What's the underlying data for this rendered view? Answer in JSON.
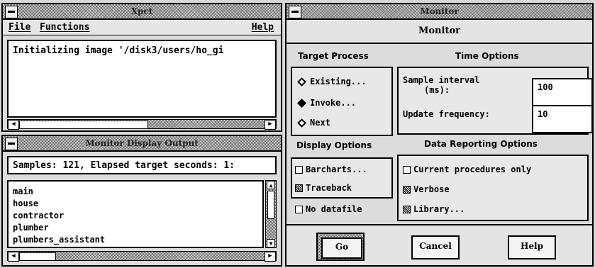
{
  "xpct": {
    "title": "Xpct",
    "menu": {
      "file": "File",
      "functions": "Functions",
      "help": "Help"
    },
    "output_text": "Initializing image '/disk3/users/ho_gi"
  },
  "display_output": {
    "title": "Monitor Display Output",
    "summary": "Samples: 121, Elapsed target seconds: 1:",
    "procedures": [
      "main",
      "house",
      "contractor",
      "plumber",
      "plumbers_assistant"
    ]
  },
  "monitor": {
    "window_title": "Monitor",
    "header": "Monitor",
    "target_process": {
      "title": "Target Process",
      "options": [
        {
          "label": "Existing...",
          "selected": false
        },
        {
          "label": "Invoke...",
          "selected": true
        },
        {
          "label": "Next",
          "selected": false
        }
      ]
    },
    "time_options": {
      "title": "Time Options",
      "sample_interval_label_1": "Sample interval",
      "sample_interval_label_2": "(ms):",
      "sample_interval_value": "100",
      "update_frequency_label": "Update frequency:",
      "update_frequency_value": "10"
    },
    "display_options": {
      "title": "Display Options",
      "barcharts": {
        "label": "Barcharts...",
        "checked": false
      },
      "traceback": {
        "label": "Traceback",
        "checked": true
      },
      "no_datafile": {
        "label": "No datafile",
        "checked": false
      }
    },
    "data_reporting": {
      "title": "Data Reporting Options",
      "current_procedures_only": {
        "label": "Current procedures only",
        "checked": false
      },
      "verbose": {
        "label": "Verbose",
        "checked": true
      },
      "library": {
        "label": "Library...",
        "checked": true
      }
    },
    "buttons": {
      "go": "Go",
      "cancel": "Cancel",
      "help": "Help"
    }
  }
}
